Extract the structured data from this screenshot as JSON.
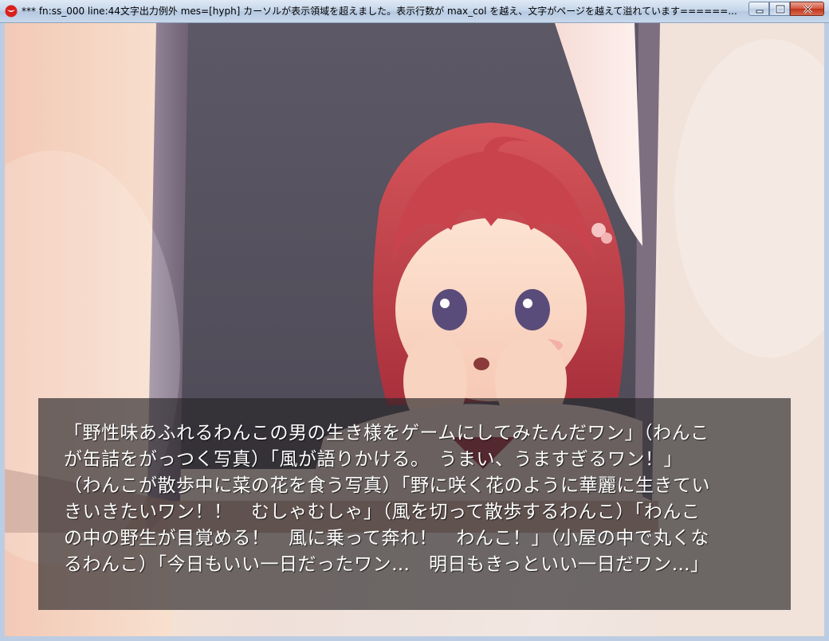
{
  "window": {
    "title": "*** fn:ss_000 line:44文字出力例外 mes=[hyph] カーソルが表示領域を超えました。表示行数が max_col を越え、文字がページを越えて溢れています======...",
    "controls": [
      "minimize",
      "maximize",
      "close"
    ]
  },
  "icons": {
    "app": "app-logo-icon",
    "minimize": "minimize-icon",
    "maximize": "maximize-icon",
    "close": "close-icon"
  },
  "scene": {
    "description_element": "game-cg-girl-at-window"
  },
  "message": {
    "lines": [
      "「野性味あふれるわんこの男の生き様をゲームにしてみたんだワン」（わんこ",
      "が缶詰をがっつく写真）「風が語りかける。　うまい、うますぎるワン！」",
      "（わんこが散歩中に菜の花を食う写真）「野に咲く花のように華麗に生きてい",
      "きいきたいワン！！　むしゃむしゃ」（風を切って散歩するわんこ）「わんこ",
      "の中の野生が目覚める！　風に乗って奔れ！　わんこ！」（小屋の中で丸くな",
      "るわんこ）「今日もいい一日だったワン…　明日もきっといい一日だワン…」"
    ]
  }
}
